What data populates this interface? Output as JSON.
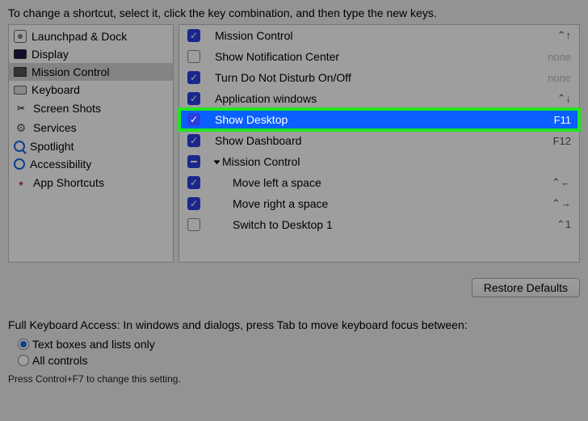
{
  "instruction": "To change a shortcut, select it, click the key combination, and then type the new keys.",
  "sidebar": {
    "items": [
      {
        "label": "Launchpad & Dock",
        "icon": "launchpad"
      },
      {
        "label": "Display",
        "icon": "display"
      },
      {
        "label": "Mission Control",
        "icon": "mcontrol",
        "selected": true
      },
      {
        "label": "Keyboard",
        "icon": "keyboard"
      },
      {
        "label": "Screen Shots",
        "icon": "screenshot"
      },
      {
        "label": "Services",
        "icon": "services"
      },
      {
        "label": "Spotlight",
        "icon": "spotlight"
      },
      {
        "label": "Accessibility",
        "icon": "access"
      },
      {
        "label": "App Shortcuts",
        "icon": "appshort"
      }
    ]
  },
  "shortcuts": [
    {
      "label": "Mission Control",
      "checked": true,
      "key": "⌃↑"
    },
    {
      "label": "Show Notification Center",
      "checked": false,
      "key": "none",
      "none": true
    },
    {
      "label": "Turn Do Not Disturb On/Off",
      "checked": true,
      "key": "none",
      "none": true
    },
    {
      "label": "Application windows",
      "checked": true,
      "key": "⌃↓"
    },
    {
      "label": "Show Desktop",
      "checked": true,
      "key": "F11",
      "selected": true,
      "highlight": true
    },
    {
      "label": "Show Dashboard",
      "checked": true,
      "key": "F12"
    },
    {
      "label": "Mission Control",
      "checked": "mixed",
      "key": "",
      "group": true
    },
    {
      "label": "Move left a space",
      "checked": true,
      "key": "⌃←",
      "indent": true
    },
    {
      "label": "Move right a space",
      "checked": true,
      "key": "⌃→",
      "indent": true
    },
    {
      "label": "Switch to Desktop 1",
      "checked": false,
      "key": "⌃1",
      "indent": true
    }
  ],
  "restore_label": "Restore Defaults",
  "fka": {
    "title": "Full Keyboard Access: In windows and dialogs, press Tab to move keyboard focus between:",
    "opt1": "Text boxes and lists only",
    "opt2": "All controls",
    "hint": "Press Control+F7 to change this setting."
  }
}
